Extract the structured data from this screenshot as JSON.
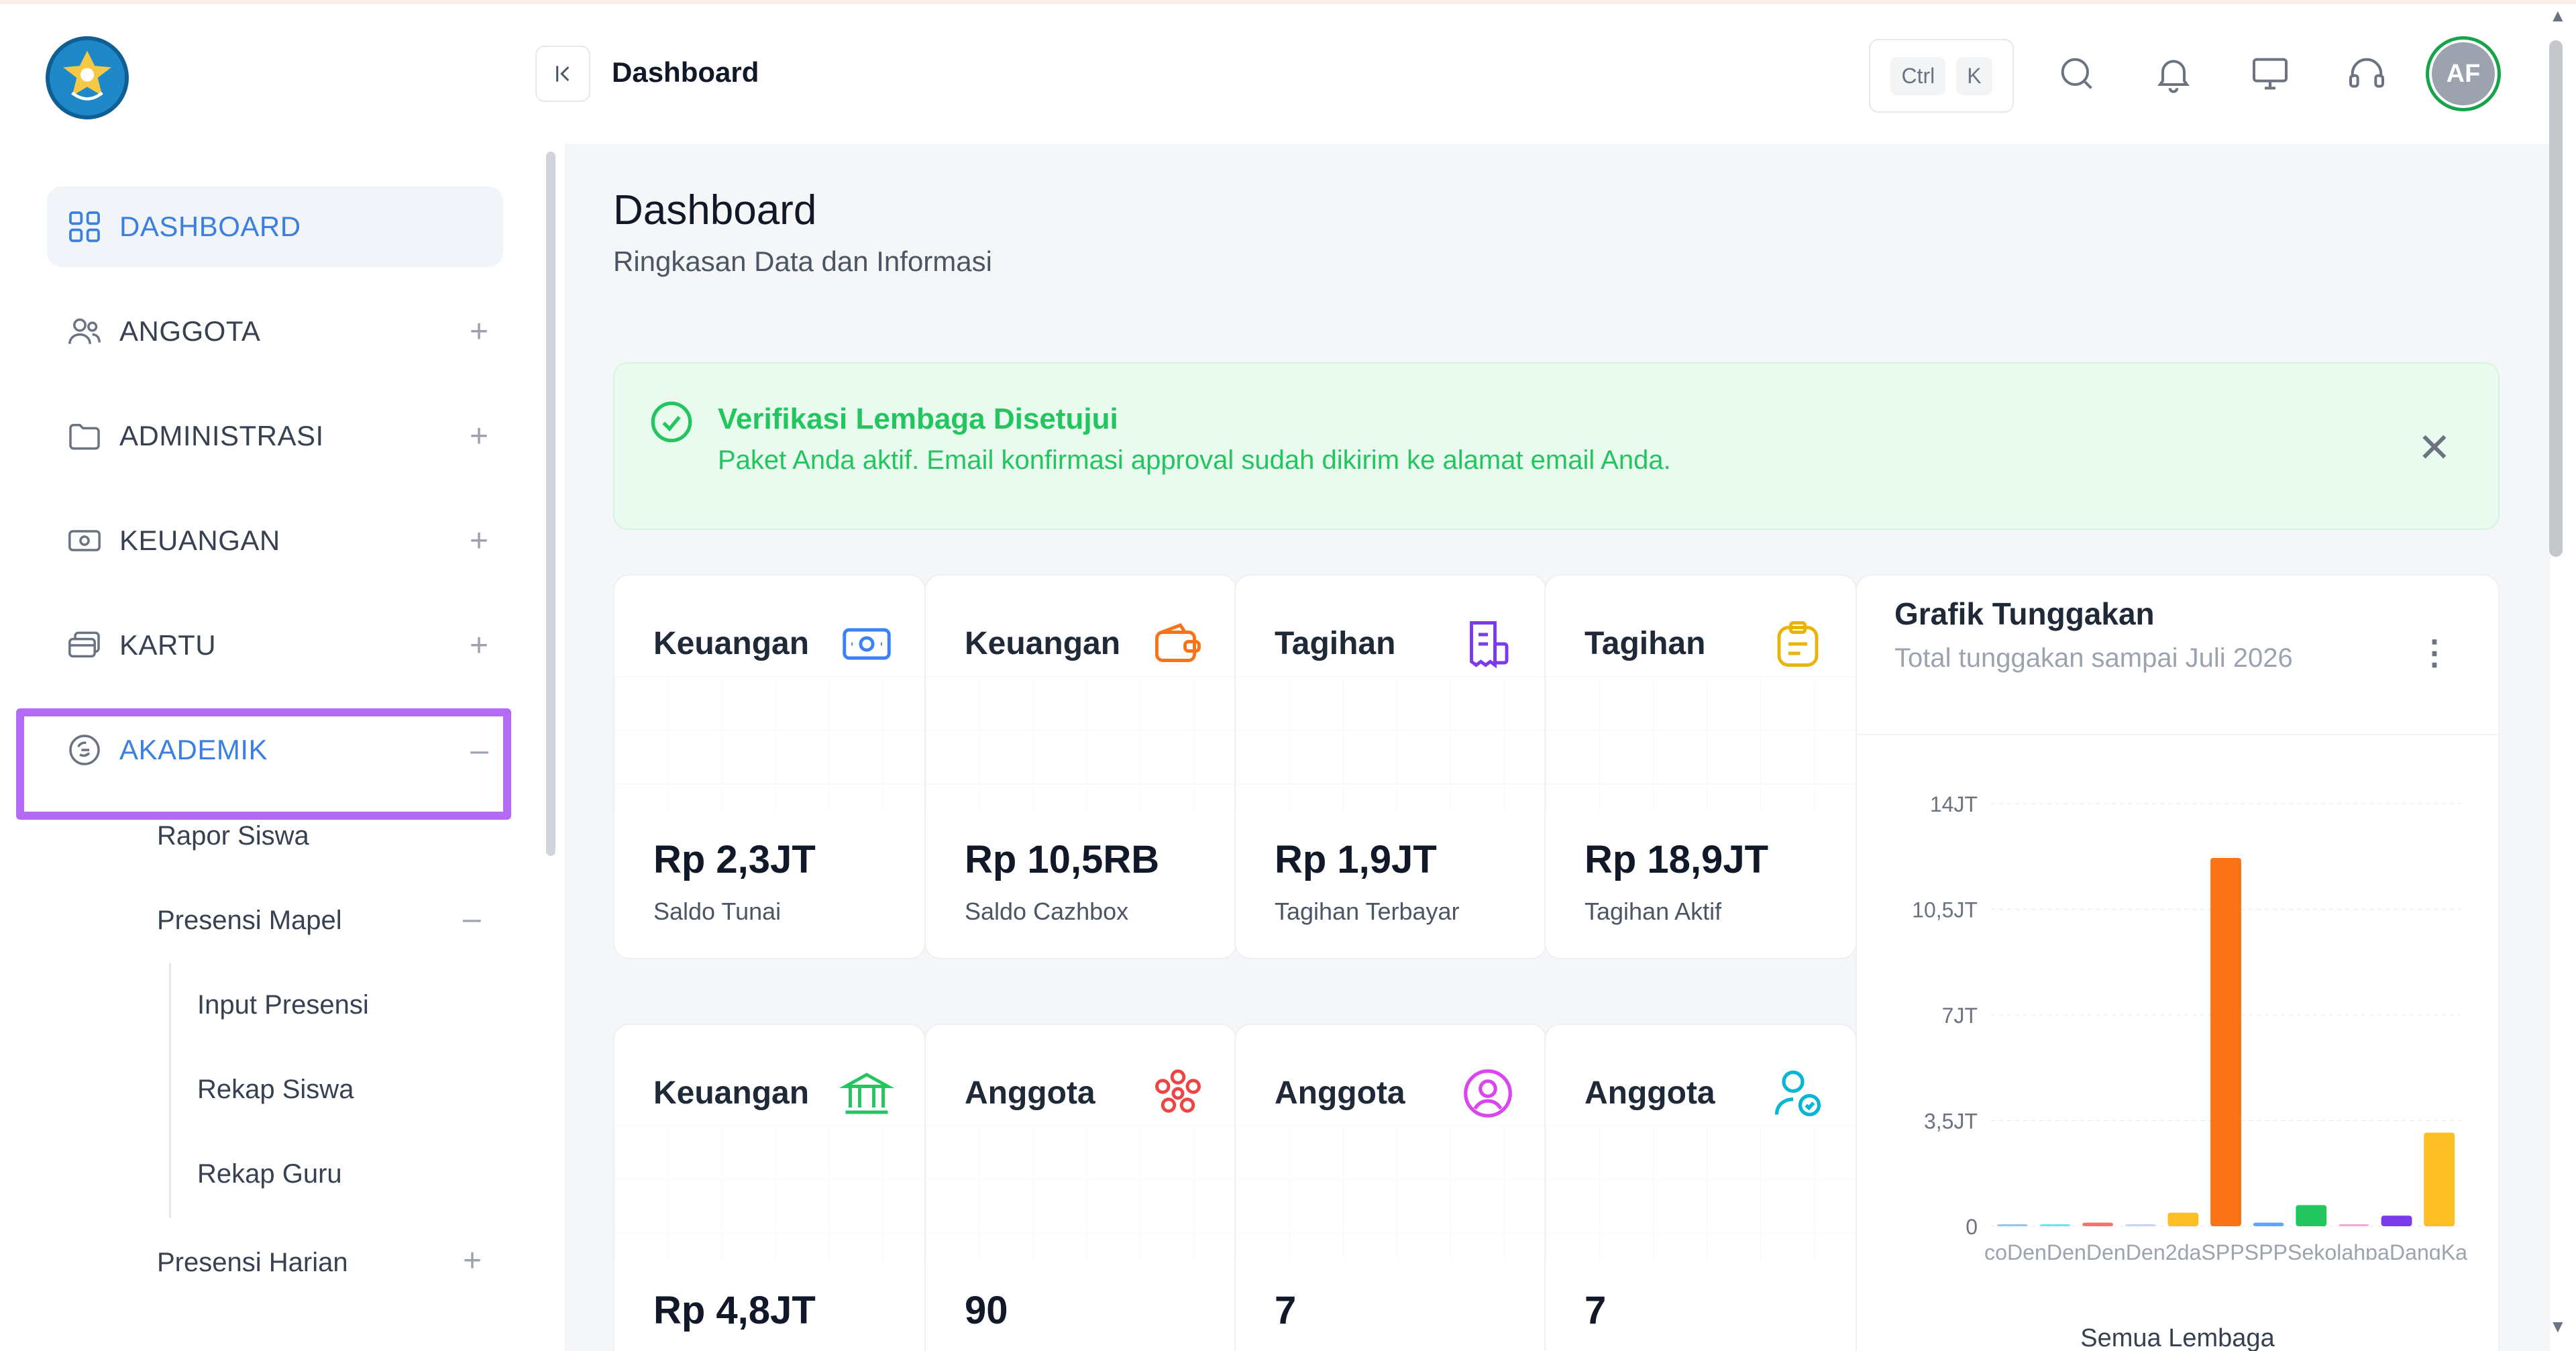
{
  "header": {
    "title": "Dashboard",
    "shortcut_ctrl": "Ctrl",
    "shortcut_k": "K",
    "avatar_initials": "AF"
  },
  "sidebar": {
    "items": [
      {
        "label": "DASHBOARD",
        "icon": "grid-icon",
        "state": "active"
      },
      {
        "label": "ANGGOTA",
        "icon": "users-icon",
        "toggle": "+"
      },
      {
        "label": "ADMINISTRASI",
        "icon": "folder-icon",
        "toggle": "+"
      },
      {
        "label": "KEUANGAN",
        "icon": "money-icon",
        "toggle": "+"
      },
      {
        "label": "KARTU",
        "icon": "cards-icon",
        "toggle": "+"
      },
      {
        "label": "AKADEMIK",
        "icon": "academic-icon",
        "toggle": "–",
        "state": "expanded"
      }
    ],
    "akademik_sub": {
      "rapor": "Rapor Siswa",
      "presensi_mapel": "Presensi Mapel",
      "presensi_mapel_toggle": "–",
      "input_presensi": "Input Presensi",
      "rekap_siswa": "Rekap Siswa",
      "rekap_guru": "Rekap Guru",
      "presensi_harian": "Presensi Harian",
      "presensi_harian_toggle": "+"
    }
  },
  "main": {
    "title": "Dashboard",
    "subtitle": "Ringkasan Data dan Informasi",
    "alert": {
      "title": "Verifikasi Lembaga Disetujui",
      "text": "Paket Anda aktif. Email konfirmasi approval sudah dikirim ke alamat email Anda.",
      "close": "✕"
    },
    "cards_row1": [
      {
        "title": "Keuangan",
        "value": "Rp 2,3JT",
        "label": "Saldo Tunai",
        "icon": "money-icon",
        "color": "#3b82f6"
      },
      {
        "title": "Keuangan",
        "value": "Rp 10,5RB",
        "label": "Saldo Cazhbox",
        "icon": "wallet-icon",
        "color": "#f97316"
      },
      {
        "title": "Tagihan",
        "value": "Rp 1,9JT",
        "label": "Tagihan Terbayar",
        "icon": "invoice-icon",
        "color": "#7c3aed"
      },
      {
        "title": "Tagihan",
        "value": "Rp 18,9JT",
        "label": "Tagihan Aktif",
        "icon": "clipboard-icon",
        "color": "#eab308"
      }
    ],
    "cards_row2": [
      {
        "title": "Keuangan",
        "value": "Rp 4,8JT",
        "icon": "bank-icon",
        "color": "#22c55e"
      },
      {
        "title": "Anggota",
        "value": "90",
        "icon": "group-icon",
        "color": "#ef4444"
      },
      {
        "title": "Anggota",
        "value": "7",
        "icon": "user-circle-icon",
        "color": "#d946ef"
      },
      {
        "title": "Anggota",
        "value": "7",
        "icon": "user-add-icon",
        "color": "#06b6d4"
      }
    ]
  },
  "chart_data": {
    "type": "bar",
    "title": "Grafik Tunggakan",
    "subtitle": "Total tunggakan sampai Juli 2026",
    "footer": "Semua Lembaga",
    "x_tick_text": "coDenDenDenDen2daSPPSPPSekolahpaDangKa",
    "yticks": [
      "14JT",
      "10,5JT",
      "7JT",
      "3,5JT",
      "0"
    ],
    "ylim": [
      0,
      14
    ],
    "y_unit": "JT",
    "grid": true,
    "values": [
      0.02,
      0.05,
      0.12,
      0.05,
      0.45,
      12.2,
      0.12,
      0.7,
      0.05,
      0.35,
      3.1
    ],
    "colors": [
      "#93c5fd",
      "#67e8f9",
      "#f87171",
      "#c7d2fe",
      "#fbbf24",
      "#f97316",
      "#60a5fa",
      "#22c55e",
      "#f9a8d4",
      "#7c3aed",
      "#fbbf24"
    ]
  }
}
